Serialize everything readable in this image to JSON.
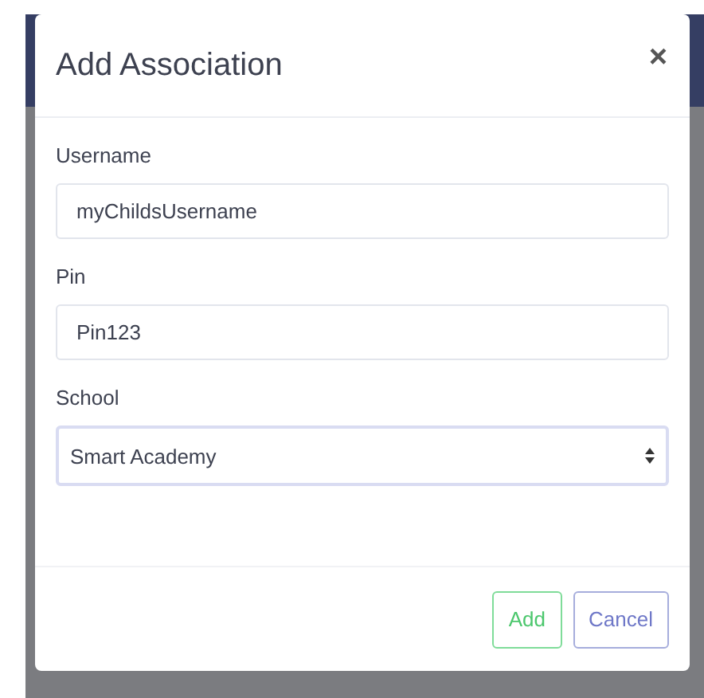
{
  "dialog": {
    "title": "Add Association",
    "close": "×"
  },
  "fields": [
    {
      "kind": "text",
      "label": "Username",
      "value": "myChildsUsername",
      "focused": false
    },
    {
      "kind": "text",
      "label": "Pin",
      "value": "Pin123",
      "focused": false
    },
    {
      "kind": "select",
      "label": "School",
      "value": "Smart Academy",
      "focused": true
    }
  ],
  "buttons": [
    {
      "kind": "primary",
      "label": "Add"
    },
    {
      "kind": "secondary",
      "label": "Cancel"
    }
  ]
}
